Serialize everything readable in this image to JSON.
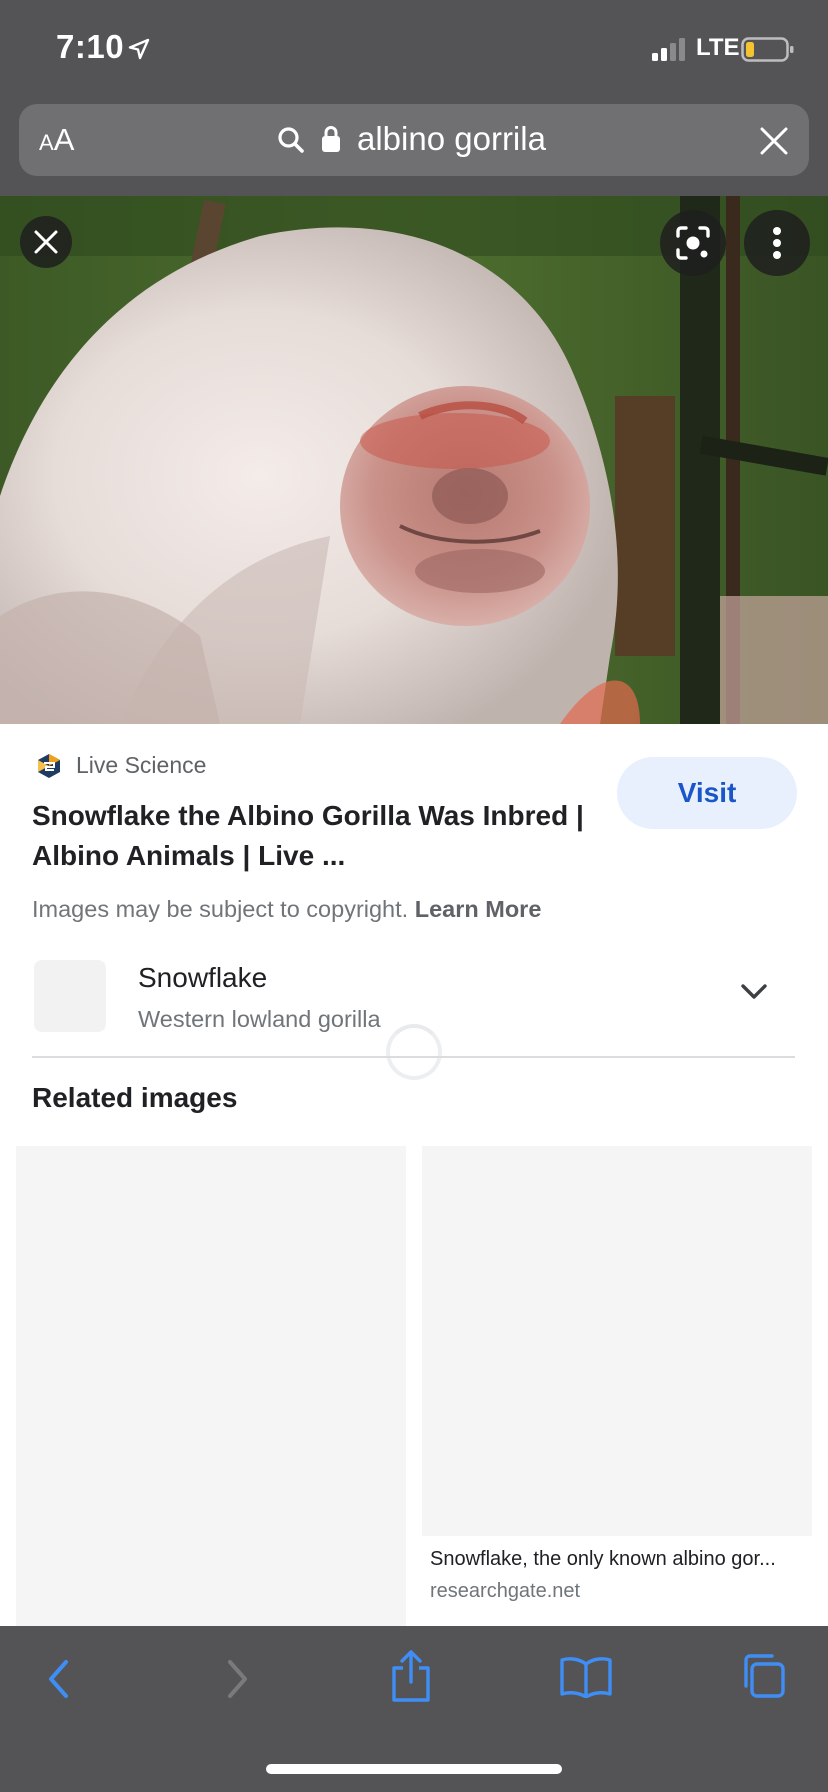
{
  "status_bar": {
    "time": "7:10",
    "network": "LTE"
  },
  "address_bar": {
    "text_size_label_small": "A",
    "text_size_label_large": "A",
    "url_text": "albino gorrila"
  },
  "image_viewer": {
    "image_subject": "Snowflake the albino gorilla",
    "close_icon": "close-icon",
    "lens_icon": "lens-icon",
    "more_icon": "more-vert-icon"
  },
  "result": {
    "source_name": "Live Science",
    "title": "Snowflake the Albino Gorilla Was Inbred | Albino Animals | Live ...",
    "visit_label": "Visit",
    "copyright_text": "Images may be subject to copyright.",
    "learn_more_label": "Learn More"
  },
  "entity": {
    "name": "Snowflake",
    "description": "Western lowland gorilla"
  },
  "related": {
    "heading": "Related images",
    "items": [
      {
        "caption": "",
        "source": ""
      },
      {
        "caption": "Snowflake, the only known albino gor...",
        "source": "researchgate.net"
      }
    ]
  },
  "toolbar": {
    "accent_color": "#3f8ef5",
    "disabled_color": "#7a7a7c"
  }
}
